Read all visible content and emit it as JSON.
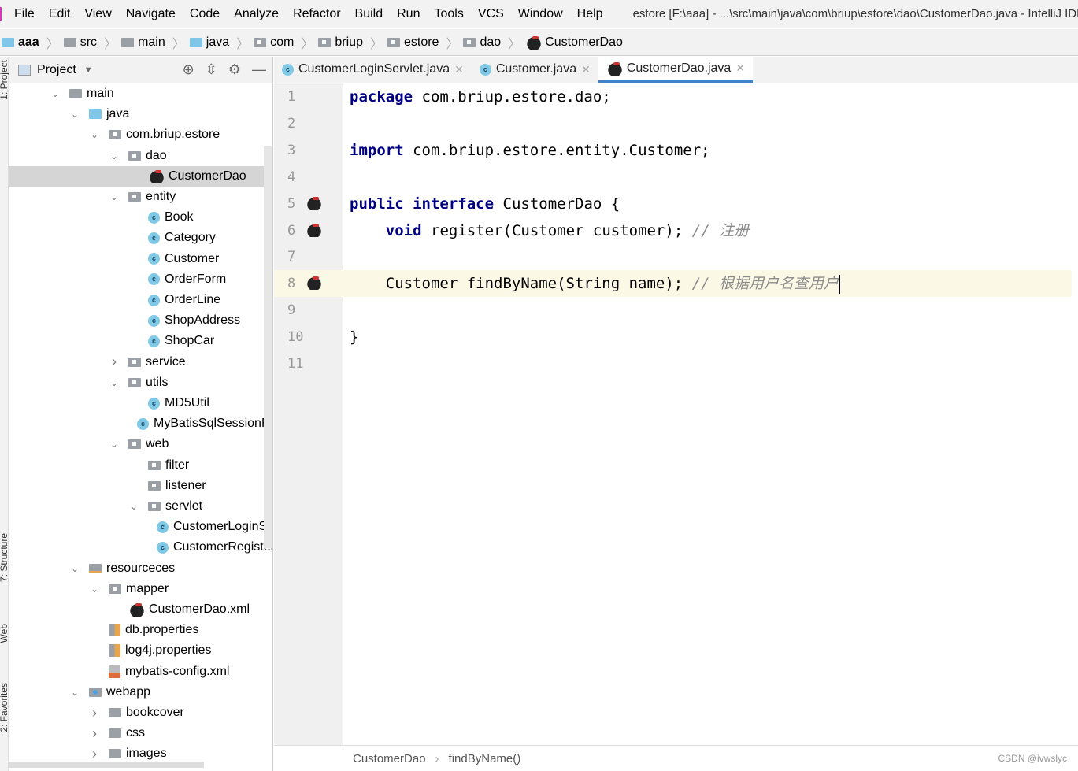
{
  "menubar": {
    "items": [
      "File",
      "Edit",
      "View",
      "Navigate",
      "Code",
      "Analyze",
      "Refactor",
      "Build",
      "Run",
      "Tools",
      "VCS",
      "Window",
      "Help"
    ],
    "window_title": "estore [F:\\aaa] - ...\\src\\main\\java\\com\\briup\\estore\\dao\\CustomerDao.java - IntelliJ IDEA"
  },
  "breadcrumbs": [
    {
      "label": "aaa",
      "icon": "module"
    },
    {
      "label": "src",
      "icon": "folder"
    },
    {
      "label": "main",
      "icon": "folder"
    },
    {
      "label": "java",
      "icon": "source-folder"
    },
    {
      "label": "com",
      "icon": "package"
    },
    {
      "label": "briup",
      "icon": "package"
    },
    {
      "label": "estore",
      "icon": "package"
    },
    {
      "label": "dao",
      "icon": "package"
    },
    {
      "label": "CustomerDao",
      "icon": "mybatis-interface"
    }
  ],
  "left_strip": {
    "project_tab": "1: Project",
    "structure_tab": "7: Structure",
    "web_tab": "Web",
    "favorites_tab": "2: Favorites"
  },
  "project_panel": {
    "title": "Project",
    "tree": [
      {
        "label": "main",
        "level": 0,
        "arrow": "expanded",
        "icon": "folder"
      },
      {
        "label": "java",
        "level": 1,
        "arrow": "expanded",
        "icon": "source-folder"
      },
      {
        "label": "com.briup.estore",
        "level": 2,
        "arrow": "expanded",
        "icon": "package"
      },
      {
        "label": "dao",
        "level": 3,
        "arrow": "expanded",
        "icon": "package"
      },
      {
        "label": "CustomerDao",
        "level": 4,
        "arrow": "none",
        "icon": "mybatis-interface",
        "selected": true
      },
      {
        "label": "entity",
        "level": 3,
        "arrow": "expanded",
        "icon": "package"
      },
      {
        "label": "Book",
        "level": 4,
        "arrow": "none",
        "icon": "class"
      },
      {
        "label": "Category",
        "level": 4,
        "arrow": "none",
        "icon": "class"
      },
      {
        "label": "Customer",
        "level": 4,
        "arrow": "none",
        "icon": "class"
      },
      {
        "label": "OrderForm",
        "level": 4,
        "arrow": "none",
        "icon": "class"
      },
      {
        "label": "OrderLine",
        "level": 4,
        "arrow": "none",
        "icon": "class"
      },
      {
        "label": "ShopAddress",
        "level": 4,
        "arrow": "none",
        "icon": "class"
      },
      {
        "label": "ShopCar",
        "level": 4,
        "arrow": "none",
        "icon": "class"
      },
      {
        "label": "service",
        "level": 3,
        "arrow": "collapsed",
        "icon": "package"
      },
      {
        "label": "utils",
        "level": 3,
        "arrow": "expanded",
        "icon": "package"
      },
      {
        "label": "MD5Util",
        "level": 4,
        "arrow": "none",
        "icon": "class"
      },
      {
        "label": "MyBatisSqlSessionFactory",
        "level": 4,
        "arrow": "none",
        "icon": "class"
      },
      {
        "label": "web",
        "level": 3,
        "arrow": "expanded",
        "icon": "package"
      },
      {
        "label": "filter",
        "level": 4,
        "arrow": "none",
        "icon": "package"
      },
      {
        "label": "listener",
        "level": 4,
        "arrow": "none",
        "icon": "package"
      },
      {
        "label": "servlet",
        "level": 4,
        "arrow": "expanded",
        "icon": "package"
      },
      {
        "label": "CustomerLoginServlet",
        "level": 5,
        "arrow": "none",
        "icon": "class"
      },
      {
        "label": "CustomerRegisterServlet",
        "level": 5,
        "arrow": "none",
        "icon": "class"
      },
      {
        "label": "resourceces",
        "level": 1,
        "arrow": "expanded",
        "icon": "resources-folder"
      },
      {
        "label": "mapper",
        "level": 2,
        "arrow": "expanded",
        "icon": "package"
      },
      {
        "label": "CustomerDao.xml",
        "level": 3,
        "arrow": "none",
        "icon": "mybatis-xml"
      },
      {
        "label": "db.properties",
        "level": 2,
        "arrow": "none",
        "icon": "properties"
      },
      {
        "label": "log4j.properties",
        "level": 2,
        "arrow": "none",
        "icon": "properties"
      },
      {
        "label": "mybatis-config.xml",
        "level": 2,
        "arrow": "none",
        "icon": "xml"
      },
      {
        "label": "webapp",
        "level": 1,
        "arrow": "expanded",
        "icon": "web-folder"
      },
      {
        "label": "bookcover",
        "level": 2,
        "arrow": "collapsed",
        "icon": "folder"
      },
      {
        "label": "css",
        "level": 2,
        "arrow": "collapsed",
        "icon": "folder"
      },
      {
        "label": "images",
        "level": 2,
        "arrow": "collapsed",
        "icon": "folder"
      }
    ]
  },
  "editor": {
    "tabs": [
      {
        "label": "CustomerLoginServlet.java",
        "icon": "class",
        "active": false
      },
      {
        "label": "Customer.java",
        "icon": "class",
        "active": false
      },
      {
        "label": "CustomerDao.java",
        "icon": "mybatis-interface",
        "active": true
      }
    ],
    "lines": [
      {
        "n": "1",
        "tokens": [
          [
            "kw",
            "package"
          ],
          [
            "",
            "com.briup.estore.dao;"
          ]
        ]
      },
      {
        "n": "2",
        "tokens": []
      },
      {
        "n": "3",
        "tokens": [
          [
            "kw",
            "import"
          ],
          [
            "",
            "com.briup.estore.entity.Customer;"
          ]
        ]
      },
      {
        "n": "4",
        "tokens": []
      },
      {
        "n": "5",
        "mark": true,
        "tokens": [
          [
            "kw",
            "public"
          ],
          [
            "kw",
            "interface"
          ],
          [
            "",
            "CustomerDao {"
          ]
        ]
      },
      {
        "n": "6",
        "mark": true,
        "tokens": [
          [
            "",
            "   "
          ],
          [
            "kw",
            "void"
          ],
          [
            "",
            "register(Customer customer);"
          ],
          [
            "cm",
            "// 注册"
          ]
        ]
      },
      {
        "n": "7",
        "tokens": []
      },
      {
        "n": "8",
        "mark": true,
        "current": true,
        "tokens": [
          [
            "",
            "    Customer findByName(String name);"
          ],
          [
            "cm",
            "// 根据用户名查用户"
          ]
        ]
      },
      {
        "n": "9",
        "tokens": []
      },
      {
        "n": "10",
        "tokens": [
          [
            "",
            "}"
          ]
        ]
      },
      {
        "n": "11",
        "tokens": []
      }
    ],
    "status_crumbs": [
      "CustomerDao",
      "findByName()"
    ]
  },
  "watermark": "CSDN @ivwslyc"
}
